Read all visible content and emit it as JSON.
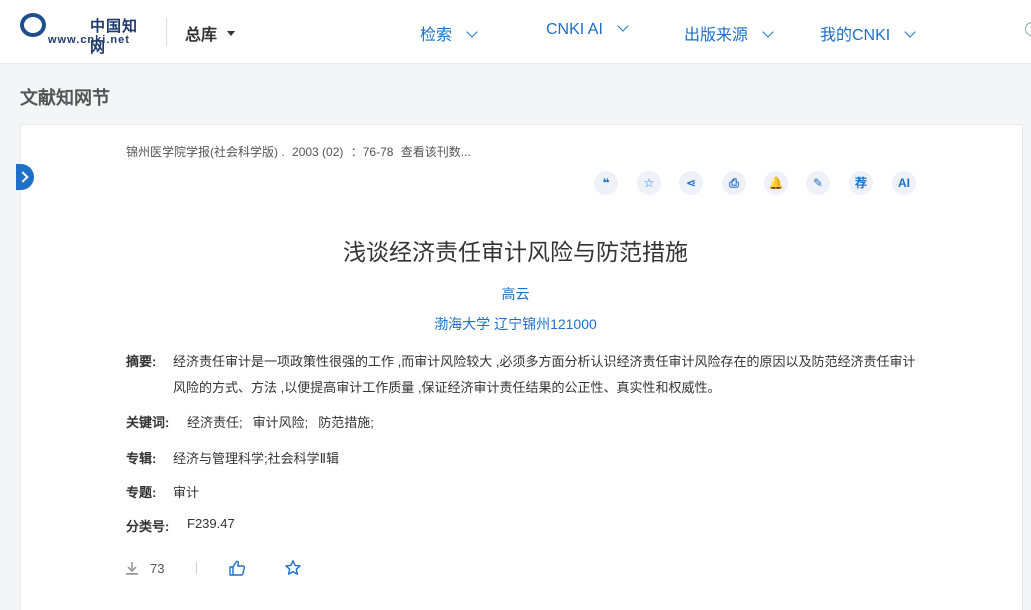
{
  "header": {
    "logo_cn": "中国知网",
    "logo_url": "www.cnki.net",
    "library": "总库",
    "nav": [
      "检索",
      "CNKI AI",
      "出版来源",
      "我的CNKI"
    ]
  },
  "section_title": "文献知网节",
  "source": {
    "journal": "锦州医学院学报(社会科学版) .",
    "issue": "2003 (02)",
    "pages": "：76-78",
    "link": "查看该刊数..."
  },
  "tools": [
    {
      "icon": "quote-icon",
      "glyph": "❝"
    },
    {
      "icon": "favorite-icon",
      "glyph": "☆"
    },
    {
      "icon": "share-icon",
      "glyph": "⋖"
    },
    {
      "icon": "print-icon",
      "glyph": "⎙"
    },
    {
      "icon": "bell-icon",
      "glyph": "🔔"
    },
    {
      "icon": "note-icon",
      "glyph": "✎"
    },
    {
      "icon": "recommend-icon",
      "glyph": "荐"
    },
    {
      "icon": "ai-icon",
      "glyph": "AI"
    }
  ],
  "article": {
    "title": "浅谈经济责任审计风险与防范措施",
    "author": "高云",
    "affiliation": "渤海大学 辽宁锦州121000",
    "abstract_label": "摘要:",
    "abstract": "经济责任审计是一项政策性很强的工作 ,而审计风险较大 ,必须多方面分析认识经济责任审计风险存在的原因以及防范经济责任审计风险的方式、方法 ,以便提高审计工作质量 ,保证经济审计责任结果的公正性、真实性和权威性。",
    "keywords_label": "关键词:",
    "keywords": [
      "经济责任;",
      "审计风险;",
      "防范措施;"
    ],
    "series_label": "专辑:",
    "series": "经济与管理科学;社会科学Ⅱ辑",
    "topic_label": "专题:",
    "topic": "审计",
    "class_label": "分类号:",
    "class": "F239.47"
  },
  "stats": {
    "downloads": "73"
  },
  "colors": {
    "accent": "#1e6fc8",
    "tool_bg": "#eef2f8"
  }
}
